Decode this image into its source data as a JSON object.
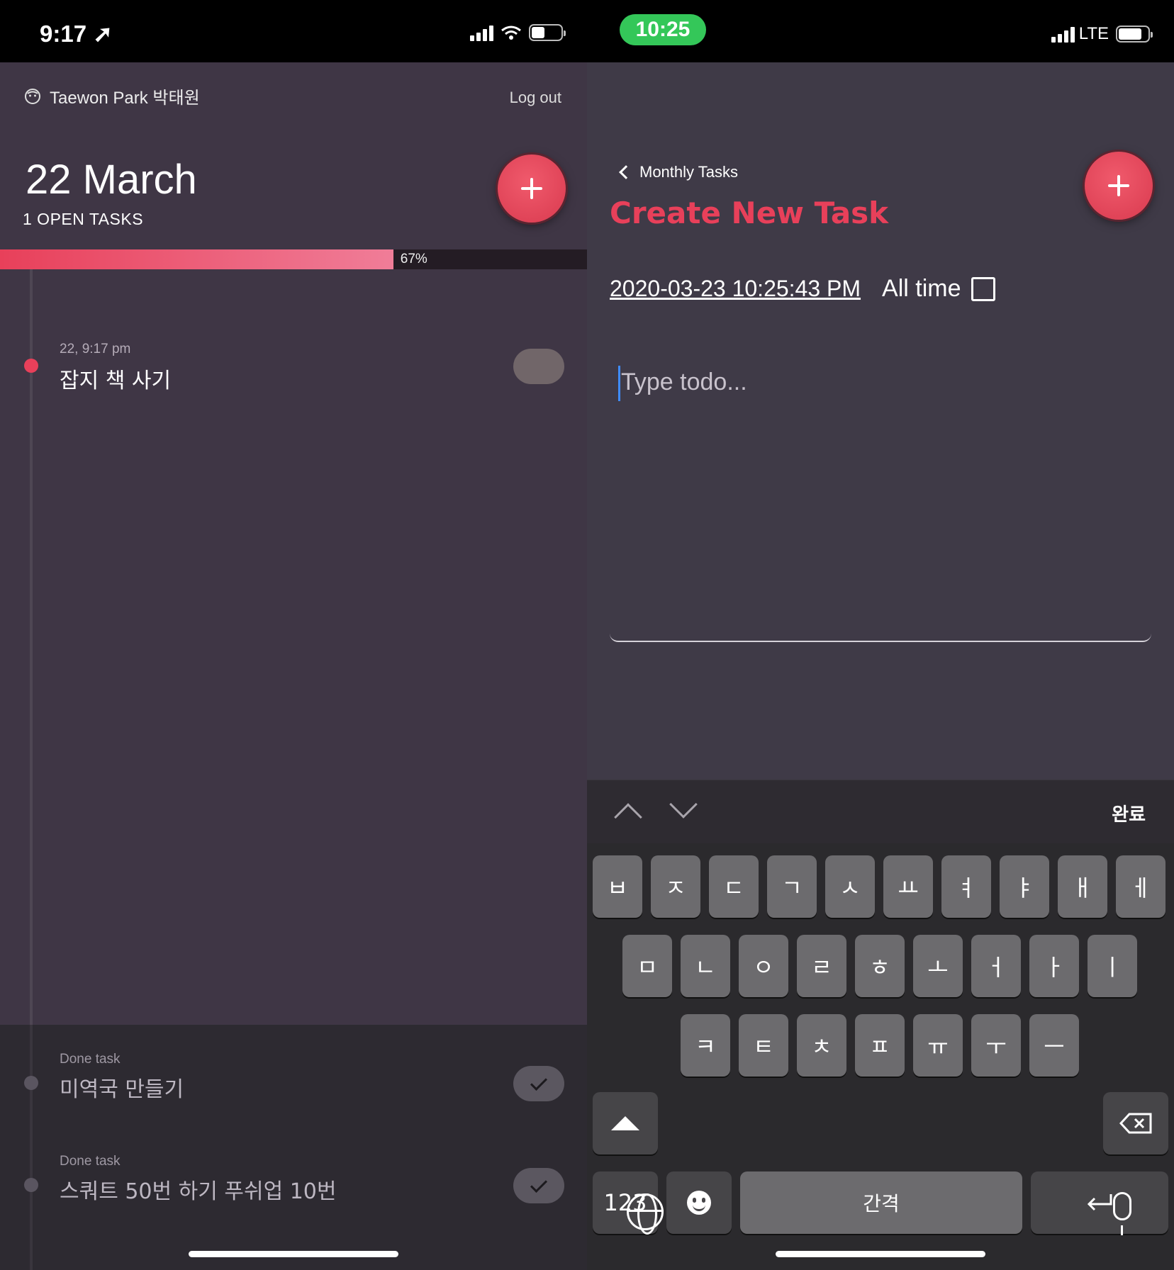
{
  "left": {
    "status": {
      "time": "9:17 ➚"
    },
    "user": {
      "name": "Taewon Park 박태원",
      "logout": "Log out"
    },
    "header": {
      "date": "22 March",
      "open_tasks": "1 OPEN TASKS"
    },
    "progress": {
      "percent": 67,
      "label": "67%"
    },
    "tasks": [
      {
        "meta": "22, 9:17 pm",
        "title": "잡지 책 사기",
        "done": false
      }
    ],
    "done_tasks": [
      {
        "meta": "Done task",
        "title": "미역국 만들기"
      },
      {
        "meta": "Done task",
        "title": "스쿼트 50번 하기 푸쉬업 10번"
      }
    ],
    "colors": {
      "accent": "#e8405a",
      "bg": "#3f3645"
    }
  },
  "right": {
    "status": {
      "time": "10:25",
      "network": "LTE"
    },
    "back_label": "Monthly Tasks",
    "title": "Create New Task",
    "datetime": "2020-03-23 10:25:43 PM",
    "all_time_label": "All time",
    "todo_placeholder": "Type todo...",
    "keyboard": {
      "done_label": "완료",
      "row1": [
        "ㅂ",
        "ㅈ",
        "ㄷ",
        "ㄱ",
        "ㅅ",
        "ㅛ",
        "ㅕ",
        "ㅑ",
        "ㅐ",
        "ㅔ"
      ],
      "row2": [
        "ㅁ",
        "ㄴ",
        "ㅇ",
        "ㄹ",
        "ㅎ",
        "ㅗ",
        "ㅓ",
        "ㅏ",
        "ㅣ"
      ],
      "row3": [
        "ㅋ",
        "ㅌ",
        "ㅊ",
        "ㅍ",
        "ㅠ",
        "ㅜ",
        "ㅡ"
      ],
      "numbers_label": "123",
      "space_label": "간격"
    }
  }
}
